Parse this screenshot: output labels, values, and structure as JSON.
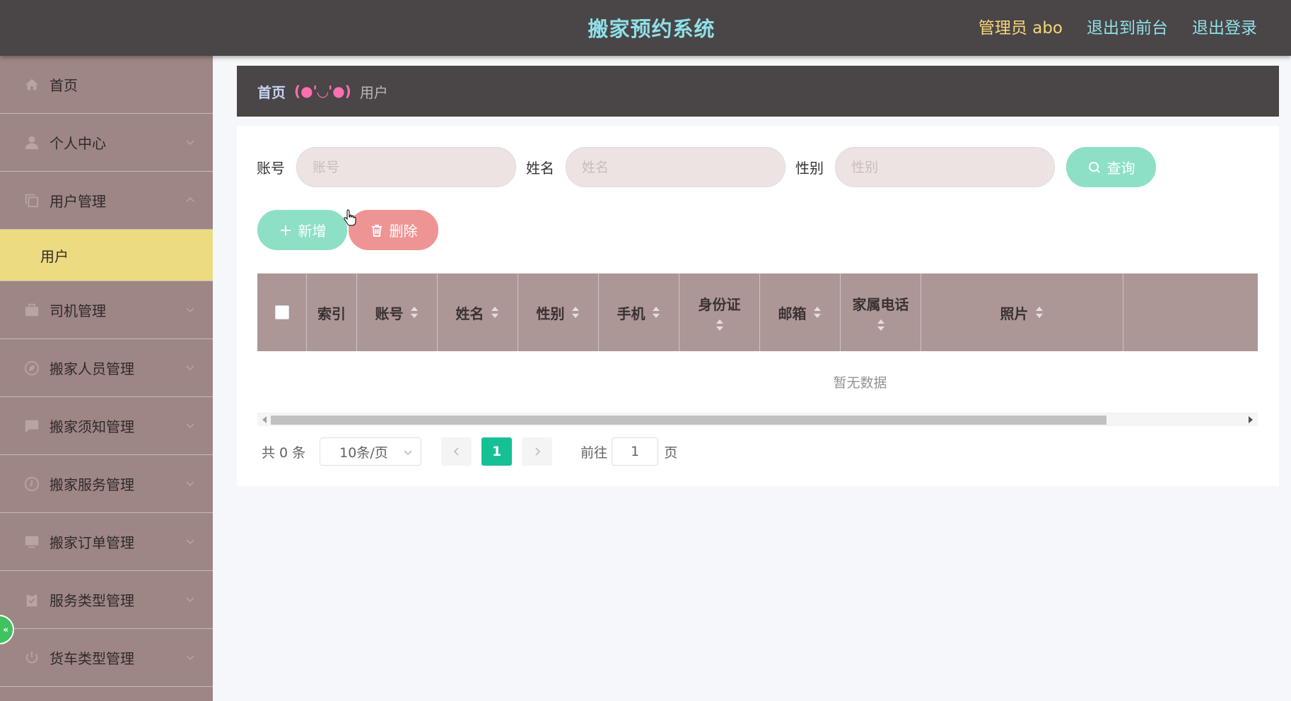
{
  "header": {
    "title": "搬家预约系统",
    "admin": "管理员 abo",
    "to_front": "退出到前台",
    "logout": "退出登录"
  },
  "sidebar": {
    "items": [
      {
        "label": "首页",
        "icon": "home-icon"
      },
      {
        "label": "个人中心",
        "icon": "user-icon"
      },
      {
        "label": "用户管理",
        "icon": "copy-icon",
        "expanded": true,
        "children": [
          {
            "label": "用户"
          }
        ]
      },
      {
        "label": "司机管理",
        "icon": "briefcase-icon"
      },
      {
        "label": "搬家人员管理",
        "icon": "compass-icon"
      },
      {
        "label": "搬家须知管理",
        "icon": "chat-icon"
      },
      {
        "label": "搬家服务管理",
        "icon": "clock-icon"
      },
      {
        "label": "搬家订单管理",
        "icon": "monitor-icon"
      },
      {
        "label": "服务类型管理",
        "icon": "clipboard-icon"
      },
      {
        "label": "货车类型管理",
        "icon": "power-icon"
      }
    ],
    "badge": "«"
  },
  "breadcrumb": {
    "home": "首页",
    "separator": "(●'◡'●)",
    "current": "用户"
  },
  "search": {
    "account_label": "账号",
    "account_placeholder": "账号",
    "name_label": "姓名",
    "name_placeholder": "姓名",
    "gender_label": "性别",
    "gender_placeholder": "性别",
    "query_label": "查询"
  },
  "actions": {
    "add_label": "新增",
    "delete_label": "删除"
  },
  "table": {
    "columns": [
      "索引",
      "账号",
      "姓名",
      "性别",
      "手机",
      "身份证",
      "邮箱",
      "家属电话",
      "照片"
    ],
    "empty_text": "暂无数据"
  },
  "pagination": {
    "total": "共 0 条",
    "page_size": "10条/页",
    "current_page": "1",
    "goto_label": "前往",
    "goto_value": "1",
    "goto_suffix": "页"
  },
  "colors": {
    "topbar": "#4a4546",
    "title": "#8fe0e8",
    "admin": "#f5d67a",
    "sidebar": "#9e8685",
    "active_sub": "#ecdb80",
    "table_head": "#ac9796",
    "primary": "#8de0c6",
    "danger": "#ef9494",
    "page_active": "#16c095"
  }
}
